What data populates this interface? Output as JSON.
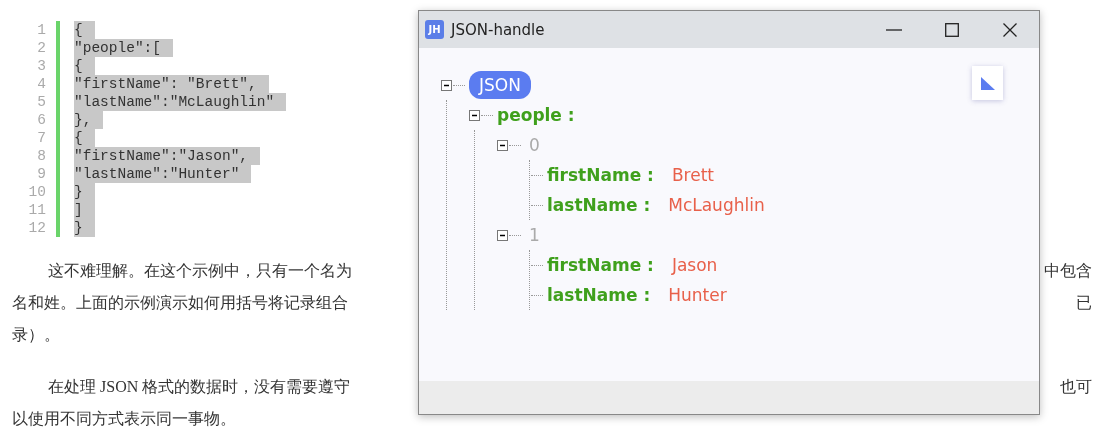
{
  "editor": {
    "lines": [
      {
        "number": "1",
        "code": "{",
        "selected": true
      },
      {
        "number": "2",
        "code": "\"people\":[",
        "selected": true
      },
      {
        "number": "3",
        "code": "{",
        "selected": true
      },
      {
        "number": "4",
        "code": "\"firstName\": \"Brett\",",
        "selected": true
      },
      {
        "number": "5",
        "code": "\"lastName\":\"McLaughlin\"",
        "selected": true
      },
      {
        "number": "6",
        "code": "},",
        "selected": true
      },
      {
        "number": "7",
        "code": "{",
        "selected": true
      },
      {
        "number": "8",
        "code": "\"firstName\":\"Jason\",",
        "selected": true
      },
      {
        "number": "9",
        "code": "\"lastName\":\"Hunter\"",
        "selected": true
      },
      {
        "number": "10",
        "code": "}",
        "selected": true
      },
      {
        "number": "11",
        "code": "]",
        "selected": true
      },
      {
        "number": "12",
        "code": "}",
        "selected": true
      }
    ]
  },
  "document": {
    "paragraphs": [
      {
        "lines": [
          {
            "left": "这不难理解。在这个示例中，只有一个名为",
            "right": "中包含"
          },
          {
            "left": "名和姓。上面的示例演示如何用括号将记录组合",
            "right": "已"
          },
          {
            "left": "录）。"
          }
        ]
      },
      {
        "lines": [
          {
            "left": "在处理 JSON 格式的数据时，没有需要遵守",
            "right": "也可"
          },
          {
            "left": "以使用不同方式表示同一事物。"
          }
        ]
      }
    ]
  },
  "window": {
    "title": "JSON-handle",
    "app_icon": "JH",
    "tree": {
      "label": "JSON",
      "expanded": true,
      "children": [
        {
          "key": "people :",
          "expanded": true,
          "children": [
            {
              "index": "0",
              "expanded": true,
              "children": [
                {
                  "key": "firstName :",
                  "value": "Brett"
                },
                {
                  "key": "lastName :",
                  "value": "McLaughlin"
                }
              ]
            },
            {
              "index": "1",
              "expanded": true,
              "children": [
                {
                  "key": "firstName :",
                  "value": "Jason"
                },
                {
                  "key": "lastName :",
                  "value": "Hunter"
                }
              ]
            }
          ]
        }
      ]
    }
  }
}
